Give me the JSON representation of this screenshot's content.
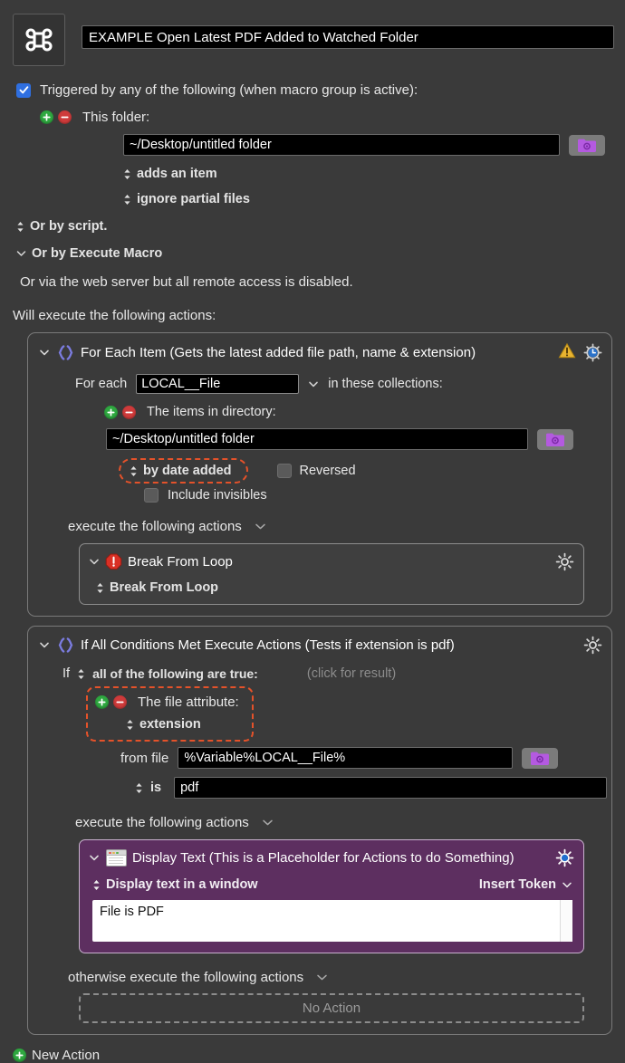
{
  "window": {
    "macro_icon": "command-symbol-icon",
    "title": "EXAMPLE Open Latest PDF Added to Watched Folder"
  },
  "trigger": {
    "checkbox_checked": true,
    "label": "Triggered by any of the following (when macro group is active):",
    "folder_trigger": {
      "add_icon": "plus-circle-icon",
      "remove_icon": "minus-circle-icon",
      "label": "This folder:",
      "path": "~/Desktop/untitled folder",
      "folder_button_icon": "folder-gear-icon",
      "event_option": "adds an item",
      "partial_option": "ignore partial files"
    },
    "or_by_script": "Or by script.",
    "or_by_execute_macro": "Or by Execute Macro",
    "web_server_note": "Or via the web server but all remote access is disabled."
  },
  "actions_header": "Will execute the following actions:",
  "for_each_block": {
    "disclosure_icon": "chevron-down-icon",
    "braces_icon": "curly-braces-icon",
    "title": "For Each Item (Gets the latest added file path, name & extension)",
    "warning_icon": "warning-triangle-icon",
    "gear_icon": "gear-clock-icon",
    "for_each_label": "For each",
    "variable": "LOCAL__File",
    "variable_dropdown_icon": "chevron-down-icon",
    "collections_label": "in these collections:",
    "add_icon": "plus-circle-icon",
    "remove_icon": "minus-circle-icon",
    "items_label": "The items in directory:",
    "directory": "~/Desktop/untitled folder",
    "folder_button_icon": "folder-gear-icon",
    "sort_option": "by date added",
    "sort_highlighted": true,
    "reversed_label": "Reversed",
    "reversed_checked": false,
    "include_invisibles_label": "Include invisibles",
    "include_invisibles_checked": false,
    "execute_label": "execute the following actions",
    "break_action": {
      "disclosure_icon": "chevron-down-icon",
      "stop_icon": "stop-exclamation-icon",
      "title": "Break From Loop",
      "gear_icon": "gear-icon",
      "option": "Break From Loop"
    }
  },
  "if_block": {
    "disclosure_icon": "chevron-down-icon",
    "braces_icon": "curly-braces-icon",
    "title": "If All Conditions Met Execute Actions (Tests if extension is pdf)",
    "gear_icon": "gear-icon",
    "if_label": "If",
    "condition_mode": "all of the following are true:",
    "click_for_result": "(click for result)",
    "condition": {
      "highlighted": true,
      "add_icon": "plus-circle-icon",
      "remove_icon": "minus-circle-icon",
      "label": "The file attribute:",
      "attribute": "extension"
    },
    "from_file_label": "from file",
    "from_file_value": "%Variable%LOCAL__File%",
    "folder_button_icon": "folder-gear-icon",
    "comparison": "is",
    "comparison_value": "pdf",
    "execute_label": "execute the following actions",
    "display_text_action": {
      "disclosure_icon": "chevron-down-icon",
      "window_icon": "window-icon",
      "title": "Display Text (This is a Placeholder for Actions to do Something)",
      "gear_icon": "gear-icon",
      "mode": "Display text in a window",
      "insert_token": "Insert Token",
      "insert_token_icon": "chevron-down-icon",
      "text": "File is PDF"
    },
    "otherwise_label": "otherwise execute the following actions",
    "no_action": "No Action"
  },
  "footer": {
    "add_icon": "plus-circle-icon",
    "new_action": "New Action"
  },
  "colors": {
    "background": "#3a3a3a",
    "accent_blue": "#2f6fe0",
    "highlight_red": "#e4522a",
    "purple_block": "#5d2f60",
    "braces_purple": "#7b7ce0",
    "green_badge": "#2fa840",
    "red_badge": "#cf3b3b"
  }
}
